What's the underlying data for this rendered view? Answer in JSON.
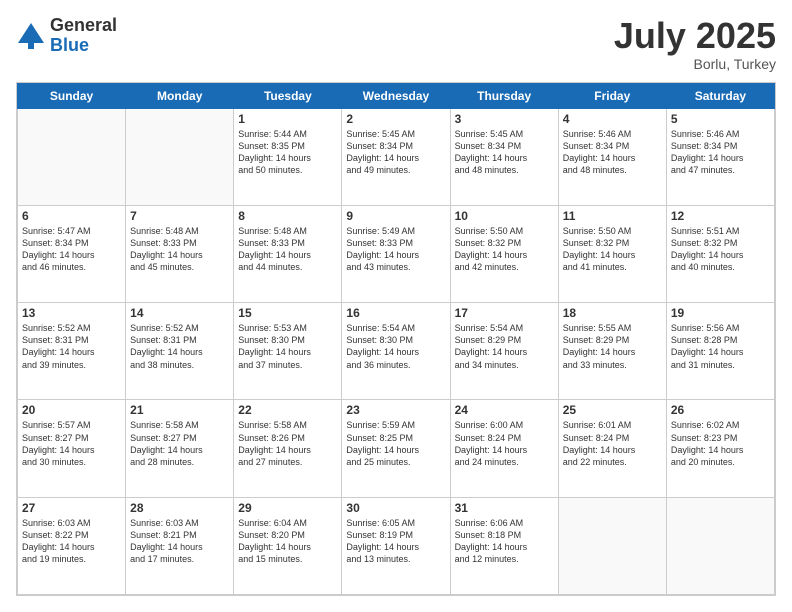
{
  "logo": {
    "general": "General",
    "blue": "Blue"
  },
  "title": "July 2025",
  "location": "Borlu, Turkey",
  "days": [
    "Sunday",
    "Monday",
    "Tuesday",
    "Wednesday",
    "Thursday",
    "Friday",
    "Saturday"
  ],
  "weeks": [
    [
      {
        "day": "",
        "text": ""
      },
      {
        "day": "",
        "text": ""
      },
      {
        "day": "1",
        "text": "Sunrise: 5:44 AM\nSunset: 8:35 PM\nDaylight: 14 hours\nand 50 minutes."
      },
      {
        "day": "2",
        "text": "Sunrise: 5:45 AM\nSunset: 8:34 PM\nDaylight: 14 hours\nand 49 minutes."
      },
      {
        "day": "3",
        "text": "Sunrise: 5:45 AM\nSunset: 8:34 PM\nDaylight: 14 hours\nand 48 minutes."
      },
      {
        "day": "4",
        "text": "Sunrise: 5:46 AM\nSunset: 8:34 PM\nDaylight: 14 hours\nand 48 minutes."
      },
      {
        "day": "5",
        "text": "Sunrise: 5:46 AM\nSunset: 8:34 PM\nDaylight: 14 hours\nand 47 minutes."
      }
    ],
    [
      {
        "day": "6",
        "text": "Sunrise: 5:47 AM\nSunset: 8:34 PM\nDaylight: 14 hours\nand 46 minutes."
      },
      {
        "day": "7",
        "text": "Sunrise: 5:48 AM\nSunset: 8:33 PM\nDaylight: 14 hours\nand 45 minutes."
      },
      {
        "day": "8",
        "text": "Sunrise: 5:48 AM\nSunset: 8:33 PM\nDaylight: 14 hours\nand 44 minutes."
      },
      {
        "day": "9",
        "text": "Sunrise: 5:49 AM\nSunset: 8:33 PM\nDaylight: 14 hours\nand 43 minutes."
      },
      {
        "day": "10",
        "text": "Sunrise: 5:50 AM\nSunset: 8:32 PM\nDaylight: 14 hours\nand 42 minutes."
      },
      {
        "day": "11",
        "text": "Sunrise: 5:50 AM\nSunset: 8:32 PM\nDaylight: 14 hours\nand 41 minutes."
      },
      {
        "day": "12",
        "text": "Sunrise: 5:51 AM\nSunset: 8:32 PM\nDaylight: 14 hours\nand 40 minutes."
      }
    ],
    [
      {
        "day": "13",
        "text": "Sunrise: 5:52 AM\nSunset: 8:31 PM\nDaylight: 14 hours\nand 39 minutes."
      },
      {
        "day": "14",
        "text": "Sunrise: 5:52 AM\nSunset: 8:31 PM\nDaylight: 14 hours\nand 38 minutes."
      },
      {
        "day": "15",
        "text": "Sunrise: 5:53 AM\nSunset: 8:30 PM\nDaylight: 14 hours\nand 37 minutes."
      },
      {
        "day": "16",
        "text": "Sunrise: 5:54 AM\nSunset: 8:30 PM\nDaylight: 14 hours\nand 36 minutes."
      },
      {
        "day": "17",
        "text": "Sunrise: 5:54 AM\nSunset: 8:29 PM\nDaylight: 14 hours\nand 34 minutes."
      },
      {
        "day": "18",
        "text": "Sunrise: 5:55 AM\nSunset: 8:29 PM\nDaylight: 14 hours\nand 33 minutes."
      },
      {
        "day": "19",
        "text": "Sunrise: 5:56 AM\nSunset: 8:28 PM\nDaylight: 14 hours\nand 31 minutes."
      }
    ],
    [
      {
        "day": "20",
        "text": "Sunrise: 5:57 AM\nSunset: 8:27 PM\nDaylight: 14 hours\nand 30 minutes."
      },
      {
        "day": "21",
        "text": "Sunrise: 5:58 AM\nSunset: 8:27 PM\nDaylight: 14 hours\nand 28 minutes."
      },
      {
        "day": "22",
        "text": "Sunrise: 5:58 AM\nSunset: 8:26 PM\nDaylight: 14 hours\nand 27 minutes."
      },
      {
        "day": "23",
        "text": "Sunrise: 5:59 AM\nSunset: 8:25 PM\nDaylight: 14 hours\nand 25 minutes."
      },
      {
        "day": "24",
        "text": "Sunrise: 6:00 AM\nSunset: 8:24 PM\nDaylight: 14 hours\nand 24 minutes."
      },
      {
        "day": "25",
        "text": "Sunrise: 6:01 AM\nSunset: 8:24 PM\nDaylight: 14 hours\nand 22 minutes."
      },
      {
        "day": "26",
        "text": "Sunrise: 6:02 AM\nSunset: 8:23 PM\nDaylight: 14 hours\nand 20 minutes."
      }
    ],
    [
      {
        "day": "27",
        "text": "Sunrise: 6:03 AM\nSunset: 8:22 PM\nDaylight: 14 hours\nand 19 minutes."
      },
      {
        "day": "28",
        "text": "Sunrise: 6:03 AM\nSunset: 8:21 PM\nDaylight: 14 hours\nand 17 minutes."
      },
      {
        "day": "29",
        "text": "Sunrise: 6:04 AM\nSunset: 8:20 PM\nDaylight: 14 hours\nand 15 minutes."
      },
      {
        "day": "30",
        "text": "Sunrise: 6:05 AM\nSunset: 8:19 PM\nDaylight: 14 hours\nand 13 minutes."
      },
      {
        "day": "31",
        "text": "Sunrise: 6:06 AM\nSunset: 8:18 PM\nDaylight: 14 hours\nand 12 minutes."
      },
      {
        "day": "",
        "text": ""
      },
      {
        "day": "",
        "text": ""
      }
    ]
  ]
}
